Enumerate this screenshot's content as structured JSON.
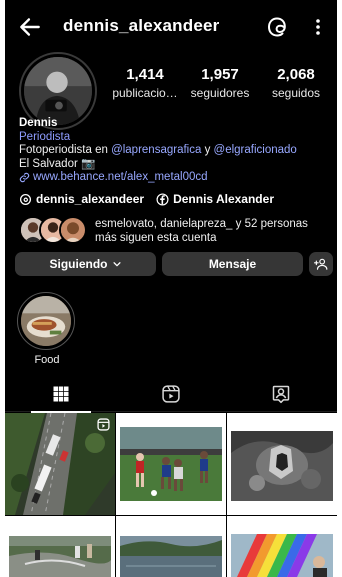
{
  "header": {
    "username": "dennis_alexandeer",
    "back_icon": "arrow-left-icon",
    "threads_icon": "threads-icon",
    "more_icon": "more-vertical-icon"
  },
  "stats": [
    {
      "value": "1,414",
      "label": "publicacio…"
    },
    {
      "value": "1,957",
      "label": "seguidores"
    },
    {
      "value": "2,068",
      "label": "seguidos"
    }
  ],
  "bio": {
    "name": "Dennis",
    "category": "Periodista",
    "line1_prefix": "Fotoperiodista en ",
    "mention1": "@laprensagrafica",
    "line1_mid": " y ",
    "mention2": "@elgraficionado",
    "line2": "El Salvador 📷",
    "link": "www.behance.net/alex_metal00cd"
  },
  "social": {
    "threads": "dennis_alexandeer",
    "facebook": "Dennis Alexander"
  },
  "followed_by": {
    "line1": "esmelovato, danielapreza_ y 52 personas",
    "line2": "más siguen esta cuenta"
  },
  "actions": {
    "following": "Siguiendo",
    "message": "Mensaje"
  },
  "highlights": [
    {
      "label": "Food"
    }
  ],
  "tabs": [
    {
      "icon": "grid-icon",
      "active": true
    },
    {
      "icon": "reels-icon",
      "active": false
    },
    {
      "icon": "tagged-icon",
      "active": false
    }
  ],
  "colors": {
    "background": "#000000",
    "button": "#363636",
    "link": "#98a8ff"
  }
}
